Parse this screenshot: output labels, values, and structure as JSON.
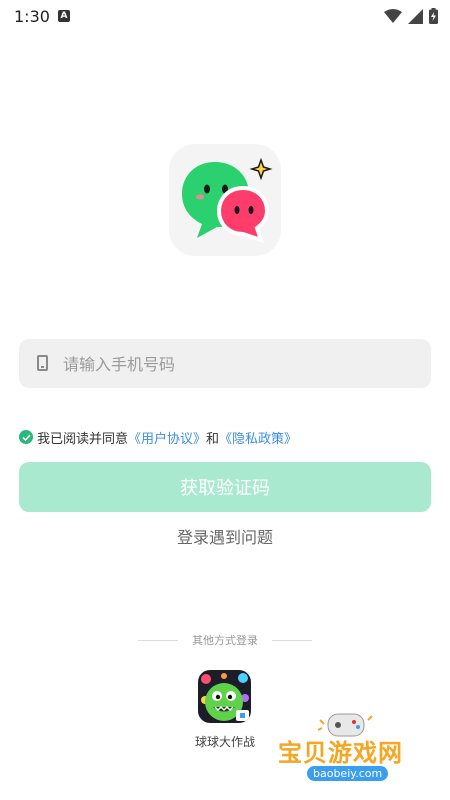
{
  "status_bar": {
    "time": "1:30",
    "notif_letter": "A"
  },
  "login": {
    "phone_placeholder": "请输入手机号码",
    "agreement_prefix": "我已阅读并同意",
    "user_agreement": "《用户协议》",
    "and": "和",
    "privacy_policy": "《隐私政策》",
    "get_code_button": "获取验证码",
    "login_problem": "登录遇到问题"
  },
  "other_login": {
    "title": "其他方式登录",
    "apps": [
      {
        "label": "球球大作战",
        "icon": "ball-game-icon"
      }
    ]
  },
  "colors": {
    "accent": "#28b87a",
    "button_disabled": "#a9e9cf",
    "link": "#3a8ee6"
  },
  "watermark": {
    "title": "宝贝游戏网",
    "domain": "baobeiy.com"
  }
}
